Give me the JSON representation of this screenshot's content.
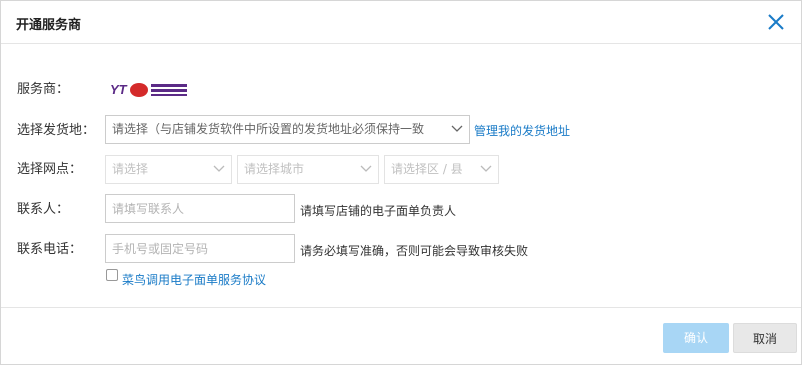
{
  "dialog": {
    "title": "开通服务商",
    "close_icon": "close-icon"
  },
  "colors": {
    "link": "#1a7bc7",
    "confirm_bg": "#a8d6f5",
    "logo_red": "#d42a2a",
    "logo_purple": "#5b2a86"
  },
  "provider": {
    "label": "服务商：",
    "logo_name": "yto-express-logo"
  },
  "ship_from": {
    "label": "选择发货地：",
    "selected": "请选择（与店铺发货软件中所设置的发货地址必须保持一致",
    "manage_link": "管理我的发货地址"
  },
  "outlet": {
    "label": "选择网点：",
    "province_placeholder": "请选择",
    "city_placeholder": "请选择城市",
    "district_placeholder": "请选择区 / 县"
  },
  "contact": {
    "label": "联系人：",
    "placeholder": "请填写联系人",
    "hint": "请填写店铺的电子面单负责人"
  },
  "phone": {
    "label": "联系电话：",
    "placeholder": "手机号或固定号码",
    "hint": "请务必填写准确，否则可能会导致审核失败"
  },
  "agreement": {
    "link": "菜鸟调用电子面单服务协议"
  },
  "footer": {
    "confirm_label": "确认",
    "cancel_label": "取消"
  }
}
